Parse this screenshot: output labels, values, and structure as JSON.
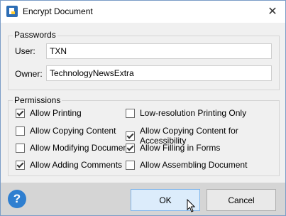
{
  "window": {
    "title": "Encrypt Document",
    "icon": "document-lock-icon",
    "close": "✕"
  },
  "passwords": {
    "legend": "Passwords",
    "user_label": "User:",
    "user_value": "TXN",
    "owner_label": "Owner:",
    "owner_value": "TechnologyNewsExtra"
  },
  "permissions": {
    "legend": "Permissions",
    "items": [
      {
        "label": "Allow Printing",
        "checked": true
      },
      {
        "label": "Allow Copying Content",
        "checked": false
      },
      {
        "label": "Allow Modifying Document",
        "checked": false
      },
      {
        "label": "Allow Adding Comments",
        "checked": true
      },
      {
        "label": "Low-resolution Printing Only",
        "checked": false
      },
      {
        "label": "Allow Copying Content for Accessibility",
        "checked": true
      },
      {
        "label": "Allow Filling in Forms",
        "checked": true
      },
      {
        "label": "Allow Assembling Document",
        "checked": false
      }
    ]
  },
  "footer": {
    "help": "?",
    "ok_label": "OK",
    "cancel_label": "Cancel"
  },
  "colors": {
    "help_blue": "#2f7fd0",
    "ok_button_bg": "#dcecfb",
    "title_icon_blue": "#2c6db5"
  }
}
